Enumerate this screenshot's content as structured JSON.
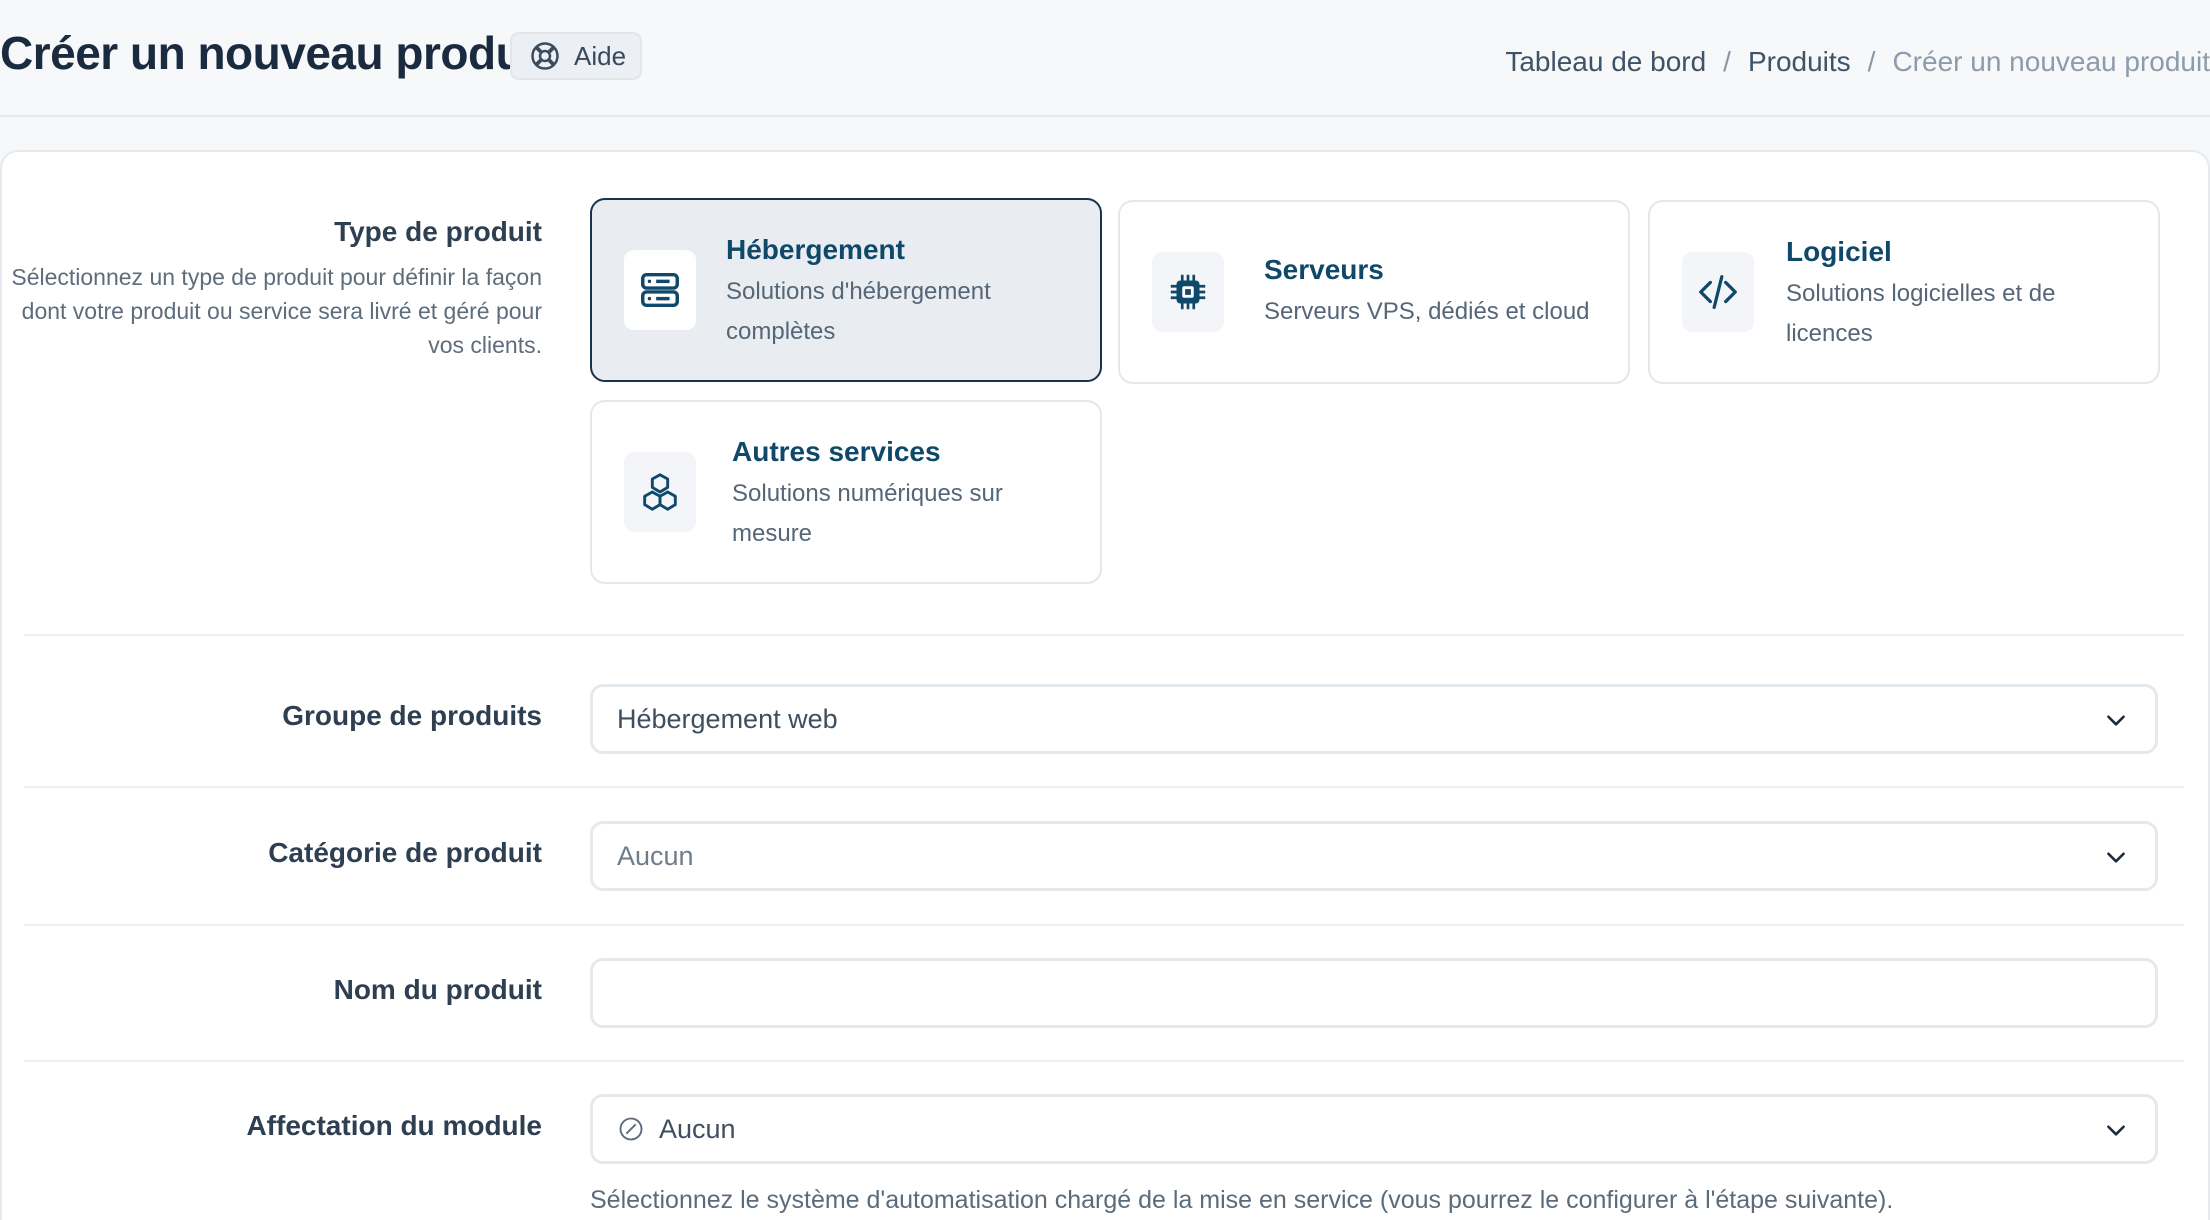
{
  "header": {
    "title": "Créer un nouveau produit",
    "help_label": "Aide",
    "breadcrumb": [
      "Tableau de bord",
      "Produits",
      "Créer un nouveau produit"
    ],
    "breadcrumb_sep": "/"
  },
  "product_type": {
    "label": "Type de produit",
    "help": "Sélectionnez un type de produit pour définir la façon dont votre produit ou service sera livré et géré pour vos clients.",
    "selected": "Hébergement",
    "cards": [
      {
        "title": "Hébergement",
        "desc": "Solutions d'hébergement complètes",
        "icon": "server-stack-icon"
      },
      {
        "title": "Serveurs",
        "desc": "Serveurs VPS, dédiés et cloud",
        "icon": "cpu-chip-icon"
      },
      {
        "title": "Logiciel",
        "desc": "Solutions logicielles et de licences",
        "icon": "code-icon"
      },
      {
        "title": "Autres services",
        "desc": "Solutions numériques sur mesure",
        "icon": "cubes-icon"
      }
    ]
  },
  "product_group": {
    "label": "Groupe de produits",
    "value": "Hébergement web"
  },
  "product_category": {
    "label": "Catégorie de produit",
    "value": "Aucun"
  },
  "product_name": {
    "label": "Nom du produit",
    "value": ""
  },
  "module": {
    "label": "Affectation du module",
    "value": "Aucun",
    "help": "Sélectionnez le système d'automatisation chargé de la mise en service (vous pourrez le configurer à l'étape suivante)."
  },
  "colors": {
    "accent": "#0f4869",
    "selected_border": "#16334f",
    "selected_bg": "#e9edf1"
  }
}
